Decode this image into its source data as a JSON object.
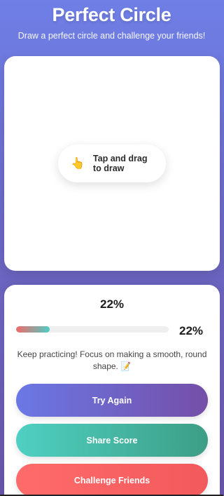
{
  "header": {
    "title": "Perfect Circle",
    "subtitle": "Draw a perfect circle and challenge your friends!"
  },
  "canvas": {
    "hint_icon": "pointing-hand-icon",
    "hint_icon_glyph": "👆",
    "hint_text": "Tap and drag to draw"
  },
  "score": {
    "headline": "22%",
    "progress_value": 0.22,
    "progress_label": "22%",
    "feedback": "Keep practicing! Focus on making a smooth, round shape. 📝"
  },
  "buttons": {
    "try_again": "Try Again",
    "share": "Share Score",
    "challenge": "Challenge Friends"
  },
  "colors": {
    "background_top": "#6f7fe6",
    "background_bottom": "#6a55a8",
    "try_again_start": "#6b78e5",
    "try_again_end": "#744fa8",
    "share_start": "#4fd0c2",
    "share_end": "#3d9e85",
    "challenge_start": "#ff6b6b",
    "challenge_end": "#f2595c"
  }
}
